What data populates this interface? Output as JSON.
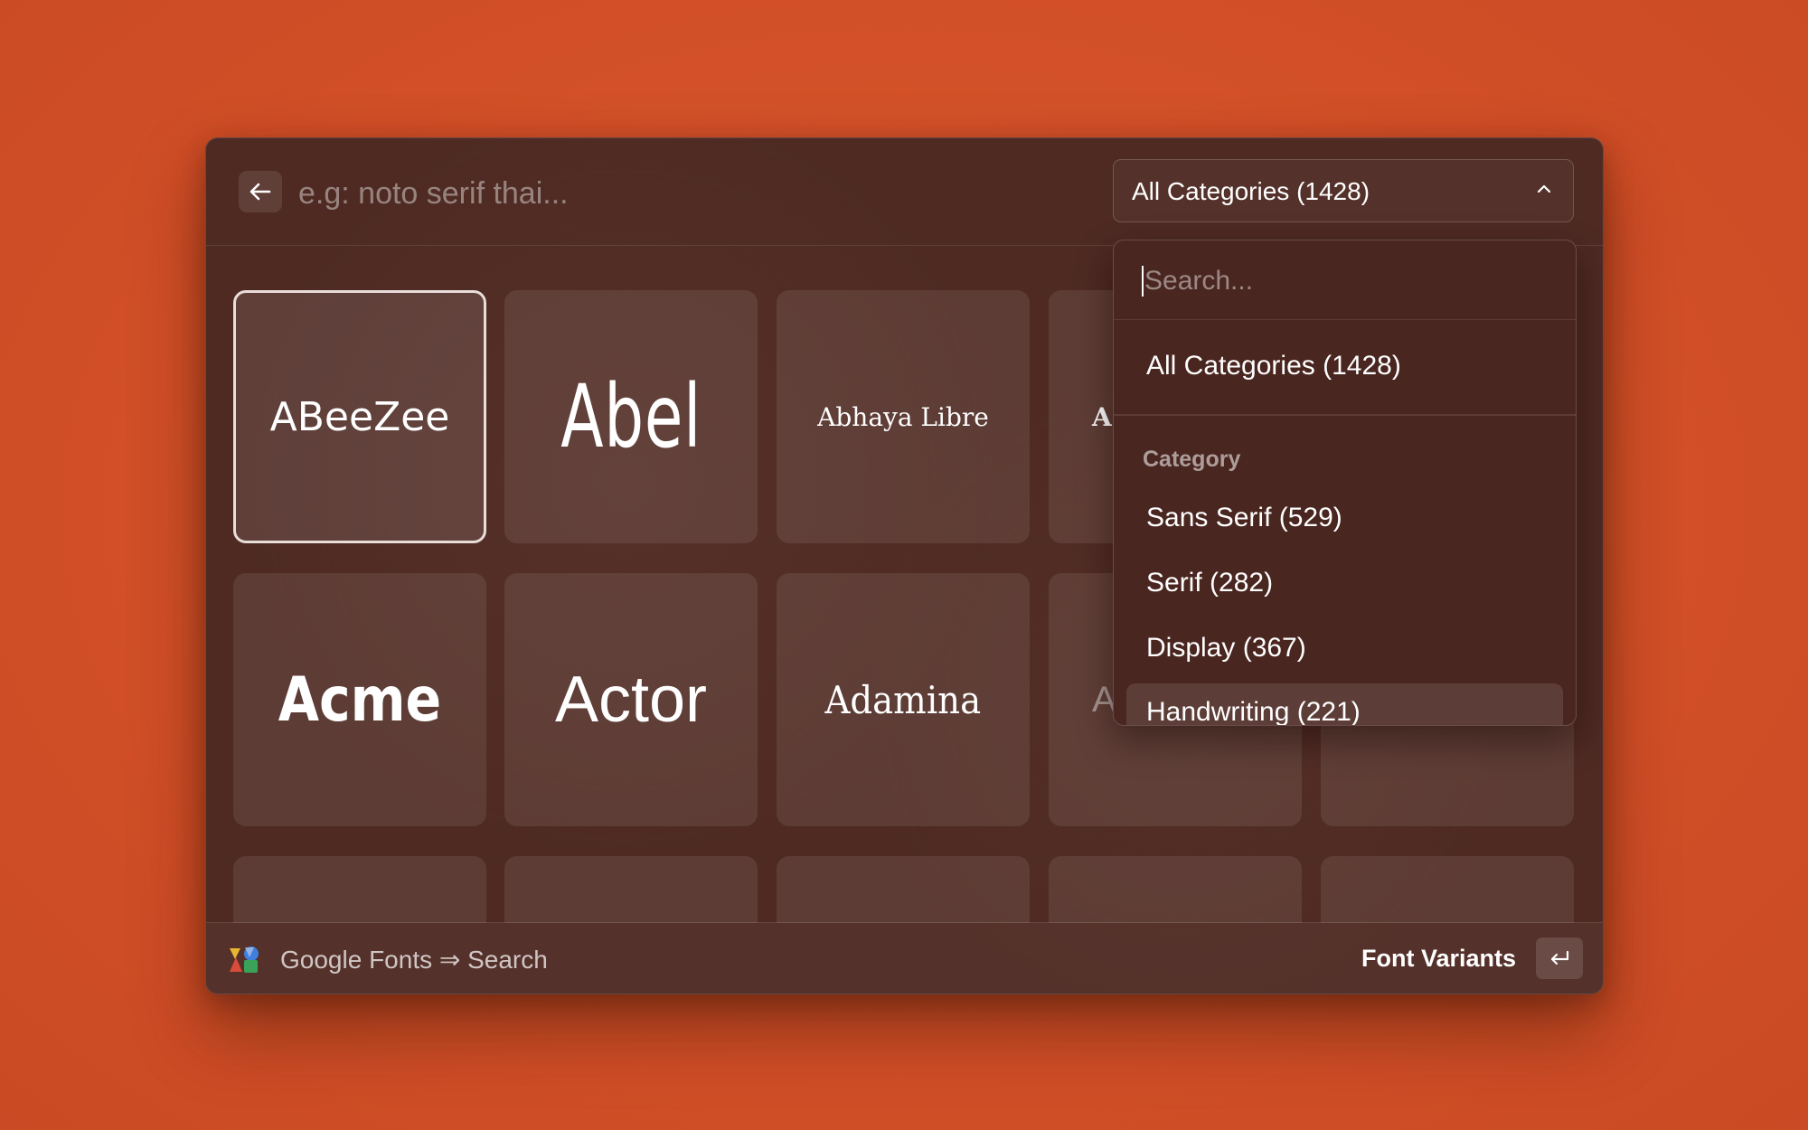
{
  "search": {
    "placeholder": "e.g: noto serif thai..."
  },
  "category_select": {
    "selected": "All Categories (1428)"
  },
  "fonts": {
    "row1": [
      "ABeeZee",
      "Abel",
      "Abhaya Libre",
      "A"
    ],
    "row2": [
      "Acme",
      "Actor",
      "Adamina",
      "A"
    ]
  },
  "dropdown": {
    "search_placeholder": "Search...",
    "all_option": "All Categories (1428)",
    "group_label": "Category",
    "items": [
      "Sans Serif (529)",
      "Serif (282)",
      "Display (367)",
      "Handwriting (221)"
    ]
  },
  "footer": {
    "breadcrumb": "Google Fonts ⇒ Search",
    "action_label": "Font Variants"
  },
  "icons": {
    "back": "arrow-left-icon",
    "chevron": "chevron-up-icon",
    "enter": "return-key-icon",
    "logo": "raycast-extension-logo"
  }
}
